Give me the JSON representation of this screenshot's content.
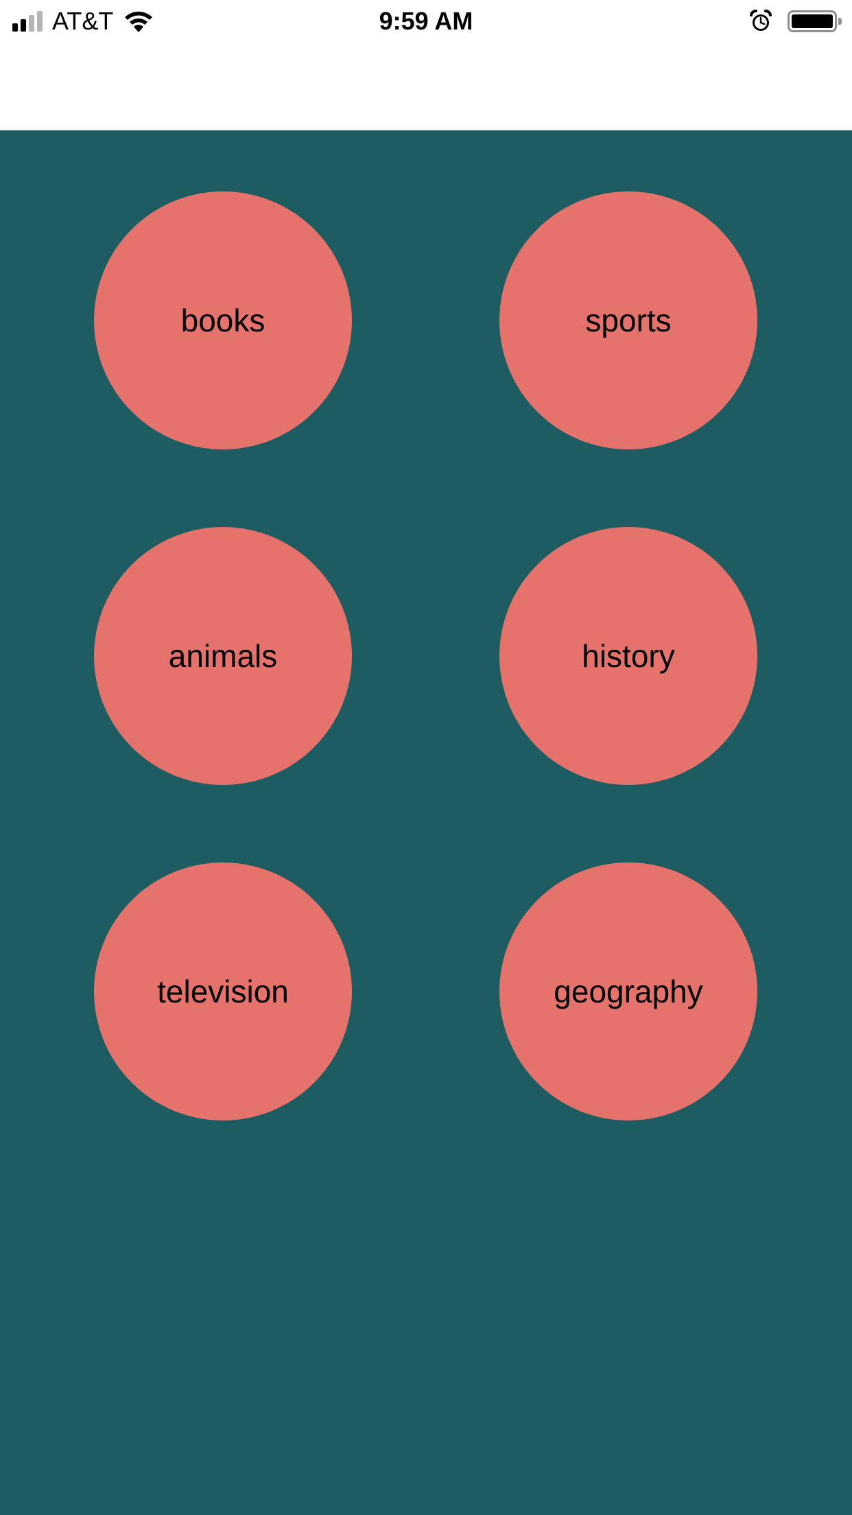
{
  "status_bar": {
    "carrier": "AT&T",
    "time": "9:59 AM",
    "signal_bars_active": 2,
    "signal_bars_total": 4,
    "battery_level": 1.0
  },
  "theme": {
    "background": "#1d5c60",
    "circle": "#e5726b",
    "label": "#000000"
  },
  "categories": [
    {
      "label": "books"
    },
    {
      "label": "sports"
    },
    {
      "label": "animals"
    },
    {
      "label": "history"
    },
    {
      "label": "television"
    },
    {
      "label": "geography"
    }
  ]
}
